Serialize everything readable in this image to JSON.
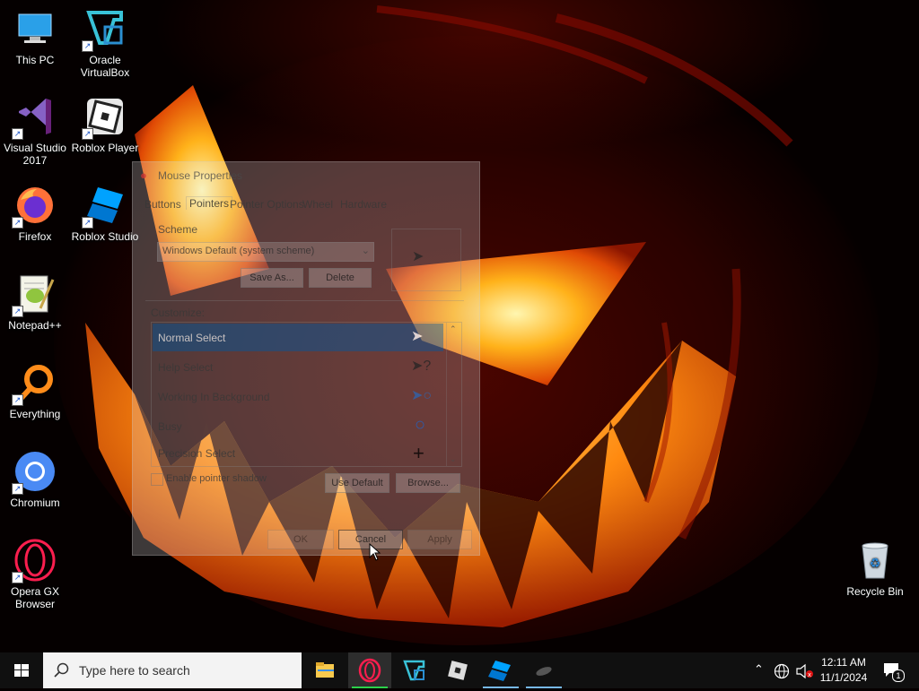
{
  "desktop": {
    "icons": [
      {
        "label": "This PC",
        "icon": "computer-icon"
      },
      {
        "label": "Oracle VirtualBox",
        "icon": "virtualbox-icon"
      },
      {
        "label": "Visual Studio 2017",
        "icon": "visual-studio-icon"
      },
      {
        "label": "Roblox Player",
        "icon": "roblox-player-icon"
      },
      {
        "label": "Firefox",
        "icon": "firefox-icon"
      },
      {
        "label": "Roblox Studio",
        "icon": "roblox-studio-icon"
      },
      {
        "label": "Notepad++",
        "icon": "notepadplusplus-icon"
      },
      {
        "label": "Everything",
        "icon": "everything-search-icon"
      },
      {
        "label": "Chromium",
        "icon": "chromium-icon"
      },
      {
        "label": "Opera GX Browser",
        "icon": "opera-gx-icon"
      },
      {
        "label": "Recycle Bin",
        "icon": "recycle-bin-icon"
      }
    ]
  },
  "dialog": {
    "title": "Mouse Properties",
    "tabs": [
      "Buttons",
      "Pointers",
      "Pointer Options",
      "Wheel",
      "Hardware"
    ],
    "active_tab": "Pointers",
    "scheme_label": "Scheme",
    "scheme_value": "Windows Default (system scheme)",
    "save_as_label": "Save As...",
    "delete_label": "Delete",
    "customize_label": "Customize:",
    "pointers": [
      {
        "name": "Normal Select",
        "selected": true,
        "icon": "arrow-pointer-icon"
      },
      {
        "name": "Help Select",
        "selected": false,
        "icon": "help-pointer-icon"
      },
      {
        "name": "Working In Background",
        "selected": false,
        "icon": "working-pointer-icon"
      },
      {
        "name": "Busy",
        "selected": false,
        "icon": "busy-pointer-icon"
      },
      {
        "name": "Precision Select",
        "selected": false,
        "icon": "precision-pointer-icon"
      }
    ],
    "enable_shadow_label": "Enable pointer shadow",
    "enable_shadow_checked": false,
    "use_default_label": "Use Default",
    "browse_label": "Browse...",
    "ok_label": "OK",
    "cancel_label": "Cancel",
    "apply_label": "Apply"
  },
  "taskbar": {
    "search_placeholder": "Type here to search",
    "apps": [
      {
        "name": "file-explorer",
        "running": false
      },
      {
        "name": "opera-gx",
        "running": true
      },
      {
        "name": "virtualbox",
        "running": false
      },
      {
        "name": "roblox-player",
        "running": false
      },
      {
        "name": "roblox-studio",
        "running": true
      },
      {
        "name": "mouse-properties",
        "running": true
      }
    ],
    "time": "12:11 AM",
    "date": "11/1/2024",
    "notification_count": "1"
  },
  "colors": {
    "accent": "#0a64ad",
    "taskbar": "#101010",
    "running_indicator": "#76b9ed"
  }
}
